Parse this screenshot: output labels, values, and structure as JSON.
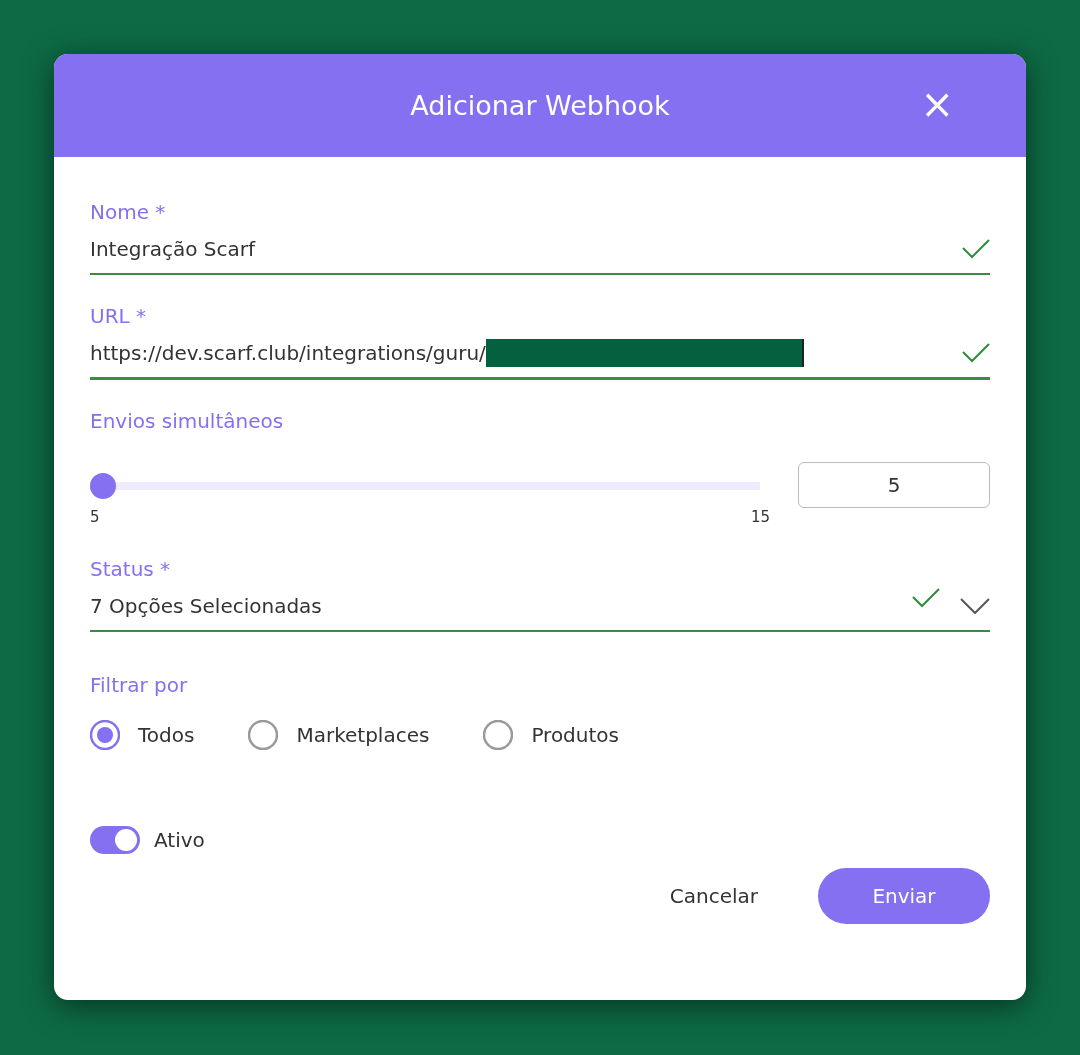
{
  "dialog": {
    "title": "Adicionar Webhook",
    "close": "×"
  },
  "fields": [
    {
      "label": "Nome *",
      "value": "Integração Scarf",
      "valid": true,
      "redacted": false
    },
    {
      "label": "URL *",
      "value": "https://dev.scarf.club/integrations/guru/",
      "valid": true,
      "redacted": true
    }
  ],
  "slider": {
    "label": "Envios simultâneos",
    "level": 0,
    "min": "5",
    "max": "15",
    "value": "5"
  },
  "status": {
    "label": "Status *",
    "value": "7 Opções Selecionadas",
    "valid": true
  },
  "filter": {
    "label": "Filtrar por",
    "options": [
      {
        "label": "Todos",
        "selected": true
      },
      {
        "label": "Marketplaces",
        "selected": false
      },
      {
        "label": "Produtos",
        "selected": false
      }
    ]
  },
  "active": {
    "label": "Ativo",
    "on": true
  },
  "buttons": [
    {
      "label": "Cancelar",
      "kind": "text"
    },
    {
      "label": "Enviar",
      "kind": "primary"
    }
  ]
}
